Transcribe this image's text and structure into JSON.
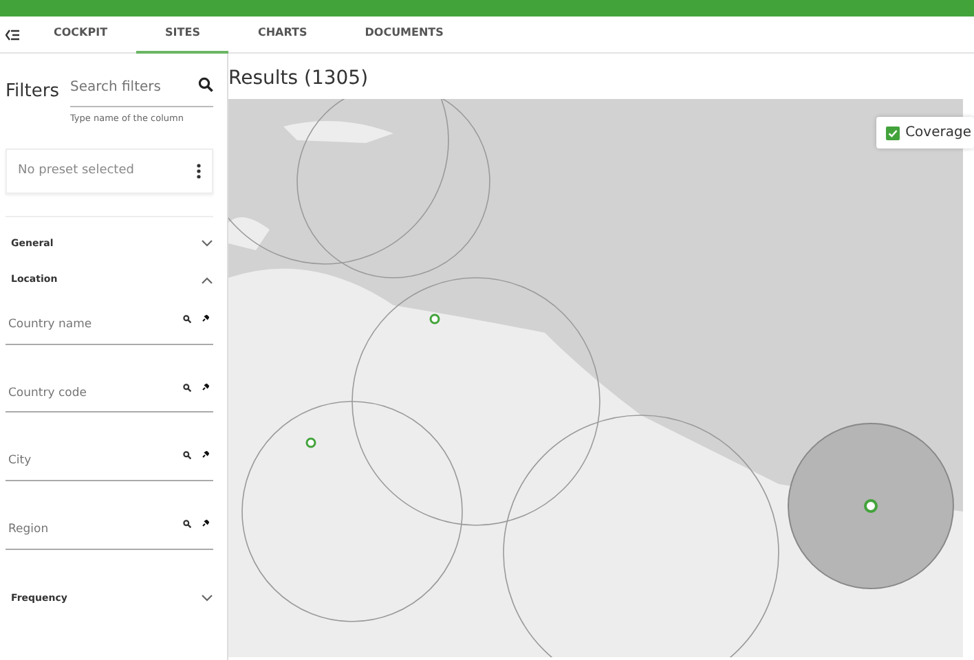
{
  "tabs": [
    {
      "label": "COCKPIT",
      "selected": false
    },
    {
      "label": "SITES",
      "selected": true
    },
    {
      "label": "CHARTS",
      "selected": false
    },
    {
      "label": "DOCUMENTS",
      "selected": false
    }
  ],
  "filters": {
    "title": "Filters",
    "search": {
      "placeholder": "Search filters",
      "hint": "Type name of the column"
    },
    "preset": "No preset selected",
    "sections": [
      {
        "label": "General",
        "expanded": false
      },
      {
        "label": "Location",
        "expanded": true,
        "fields": [
          {
            "placeholder": "Country name"
          },
          {
            "placeholder": "Country code"
          },
          {
            "placeholder": "City"
          },
          {
            "placeholder": "Region"
          }
        ]
      },
      {
        "label": "Frequency",
        "expanded": false
      }
    ]
  },
  "results": {
    "title": "Results (1305)",
    "map": {
      "kind": "picture",
      "layer": {
        "label": "Coverage",
        "checked": true
      }
    }
  }
}
